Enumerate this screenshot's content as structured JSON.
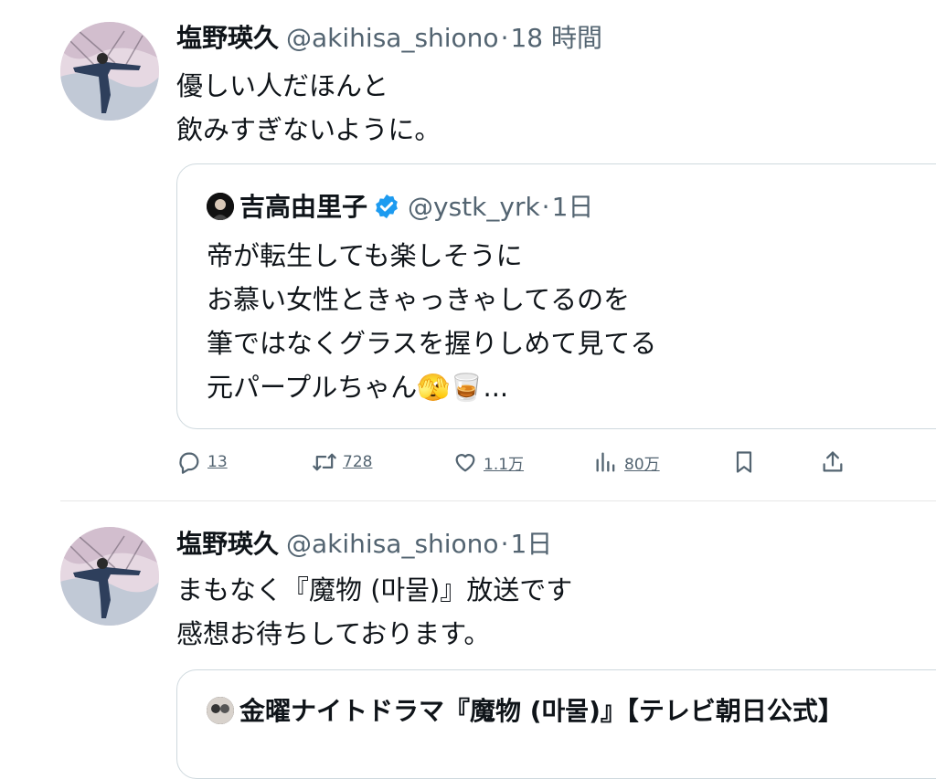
{
  "tweets": [
    {
      "author": "塩野瑛久",
      "handle": "@akihisa_shiono",
      "separator": "·",
      "time": "18 時間",
      "lines": [
        "優しい人だほんと",
        "飲みすぎないように。"
      ],
      "quote": {
        "author": "吉高由里子",
        "handle": "@ystk_yrk",
        "separator": "·",
        "time": "1日",
        "lines": [
          "帝が転生しても楽しそうに",
          "お慕い女性ときゃっきゃしてるのを",
          "筆ではなくグラスを握りしめて見てる",
          "元パープルちゃん🫣🥃..."
        ]
      },
      "actions": {
        "replies": "13",
        "reposts": "728",
        "likes": "1.1万",
        "views": "80万"
      }
    },
    {
      "author": "塩野瑛久",
      "handle": "@akihisa_shiono",
      "separator": "·",
      "time": "1日",
      "lines": [
        "まもなく『魔物 (마물)』放送です",
        "感想お待ちしております。"
      ],
      "quote": {
        "author": "金曜ナイトドラマ『魔物 (마물)』【テレビ朝日公式】"
      }
    }
  ],
  "icons": {
    "reply": "speech-bubble-icon",
    "repost": "repost-arrows-icon",
    "like": "heart-icon",
    "views": "bar-chart-icon",
    "bookmark": "bookmark-icon",
    "share": "share-upload-icon",
    "verified": "verified-badge-icon"
  },
  "colors": {
    "text": "#0f1419",
    "secondary": "#536471",
    "verified": "#1d9bf0",
    "border": "#cfd9de"
  }
}
